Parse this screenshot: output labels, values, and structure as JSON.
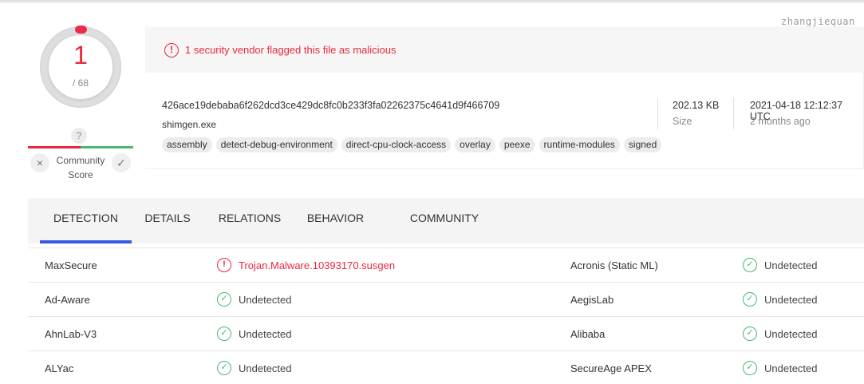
{
  "watermark": "zhangjiequan",
  "score": {
    "detections": "1",
    "total": "/ 68",
    "question_mark": "?",
    "community_label": "Community Score",
    "downvote_glyph": "×",
    "upvote_glyph": "✓"
  },
  "alert": {
    "icon_glyph": "!",
    "text": "1 security vendor flagged this file as malicious"
  },
  "file": {
    "hash": "426ace19debaba6f262dcd3ce429dc8fc0b233f3fa02262375c4641d9f466709",
    "name": "shimgen.exe",
    "tags": [
      "assembly",
      "detect-debug-environment",
      "direct-cpu-clock-access",
      "overlay",
      "peexe",
      "runtime-modules",
      "signed"
    ],
    "size_value": "202.13 KB",
    "size_label": "Size",
    "date_value": "2021-04-18 12:12:37 UTC",
    "date_label": "2 months ago"
  },
  "tabs": [
    "DETECTION",
    "DETAILS",
    "RELATIONS",
    "BEHAVIOR",
    "COMMUNITY"
  ],
  "active_tab": "DETECTION",
  "detections": [
    {
      "left_vendor": "MaxSecure",
      "left_result": "Trojan.Malware.10393170.susgen",
      "left_status": "malicious",
      "right_vendor": "Acronis (Static ML)",
      "right_result": "Undetected",
      "right_status": "undetected"
    },
    {
      "left_vendor": "Ad-Aware",
      "left_result": "Undetected",
      "left_status": "undetected",
      "right_vendor": "AegisLab",
      "right_result": "Undetected",
      "right_status": "undetected"
    },
    {
      "left_vendor": "AhnLab-V3",
      "left_result": "Undetected",
      "left_status": "undetected",
      "right_vendor": "Alibaba",
      "right_result": "Undetected",
      "right_status": "undetected"
    },
    {
      "left_vendor": "ALYac",
      "left_result": "Undetected",
      "left_status": "undetected",
      "right_vendor": "SecureAge APEX",
      "right_result": "Undetected",
      "right_status": "undetected"
    }
  ],
  "colors": {
    "malicious": "#e8293f",
    "undetected": "#48b877",
    "accent": "#3d58e0"
  },
  "icons": {
    "alert": "alert-circle-icon",
    "ok": "check-circle-icon",
    "bad": "alert-circle-icon"
  }
}
